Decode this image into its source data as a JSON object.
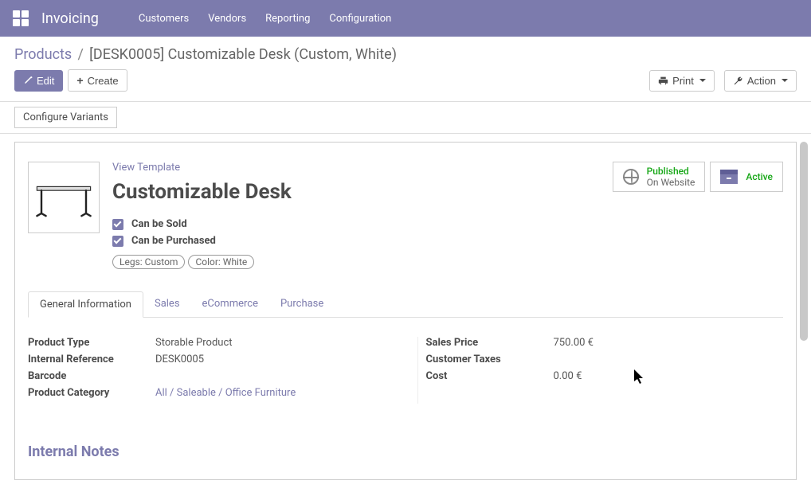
{
  "nav": {
    "brand": "Invoicing",
    "links": [
      "Customers",
      "Vendors",
      "Reporting",
      "Configuration"
    ]
  },
  "breadcrumb": {
    "parent": "Products",
    "current": "[DESK0005] Customizable Desk (Custom, White)"
  },
  "buttons": {
    "edit": "Edit",
    "create": "Create",
    "print": "Print",
    "action": "Action",
    "configure_variants": "Configure Variants"
  },
  "product": {
    "view_template": "View Template",
    "title": "Customizable Desk",
    "can_sold": "Can be Sold",
    "can_purchased": "Can be Purchased",
    "tags": [
      "Legs: Custom",
      "Color: White"
    ]
  },
  "status": {
    "published": "Published",
    "on_website": "On Website",
    "active": "Active"
  },
  "tabs": [
    "General Information",
    "Sales",
    "eCommerce",
    "Purchase"
  ],
  "fields_left": {
    "product_type_label": "Product Type",
    "product_type": "Storable Product",
    "internal_ref_label": "Internal Reference",
    "internal_ref": "DESK0005",
    "barcode_label": "Barcode",
    "barcode": "",
    "category_label": "Product Category",
    "category": "All / Saleable / Office Furniture"
  },
  "fields_right": {
    "sales_price_label": "Sales Price",
    "sales_price": "750.00 €",
    "taxes_label": "Customer Taxes",
    "taxes": "",
    "cost_label": "Cost",
    "cost": "0.00 €"
  },
  "section": {
    "internal_notes": "Internal Notes"
  }
}
